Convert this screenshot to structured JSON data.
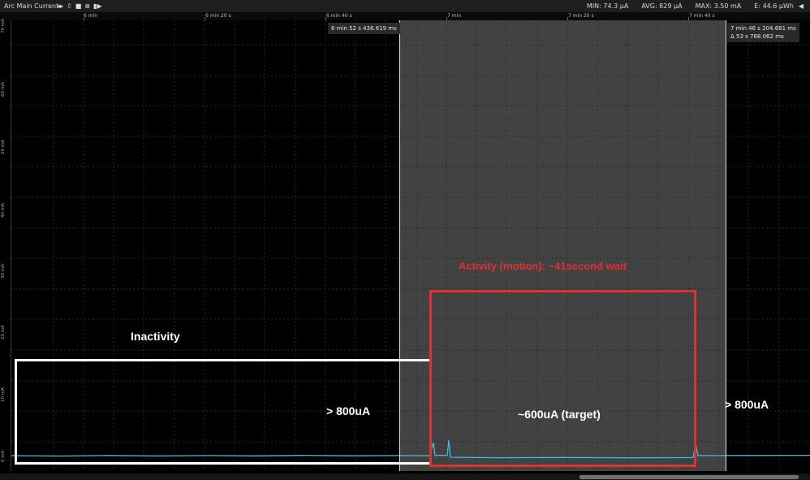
{
  "toolbar": {
    "title": "Arc Main Current",
    "icons": [
      "pan-arrows-icon",
      "zoom-arrows-icon",
      "stop-icon",
      "close-circle-icon",
      "step-play-icon"
    ],
    "stats": {
      "min": "MIN: 74.3 µA",
      "avg": "AVG: 829 µA",
      "max": "MAX: 3.50 mA",
      "energy": "E: 44.6 µWh"
    }
  },
  "time_axis": {
    "labels": [
      "6 min",
      "6 min 20 s",
      "6 min 40 s",
      "7 min",
      "7 min 20 s",
      "7 min 40 s"
    ]
  },
  "y_axis": {
    "labels": [
      "70 mA",
      "60 mA",
      "50 mA",
      "40 mA",
      "30 mA",
      "20 mA",
      "10 mA",
      "0 mA"
    ]
  },
  "cursors": {
    "left_label": "6 min 52 s 436.619 ms",
    "right_label_time": "7 min 46 s 204.681 ms",
    "right_label_delta": "Δ 53 s 768.062 ms"
  },
  "annotations": {
    "inactivity": "Inactivity",
    "left_value": "> 800uA",
    "activity": "Activity (motion): ~41second wait",
    "target_value": "~600uA (target)",
    "right_value": "> 800uA"
  },
  "colors": {
    "trace": "#33c3e0",
    "highlight_box": "#e03030",
    "annotation_red": "#e03030",
    "annotation_white": "#ffffff"
  }
}
